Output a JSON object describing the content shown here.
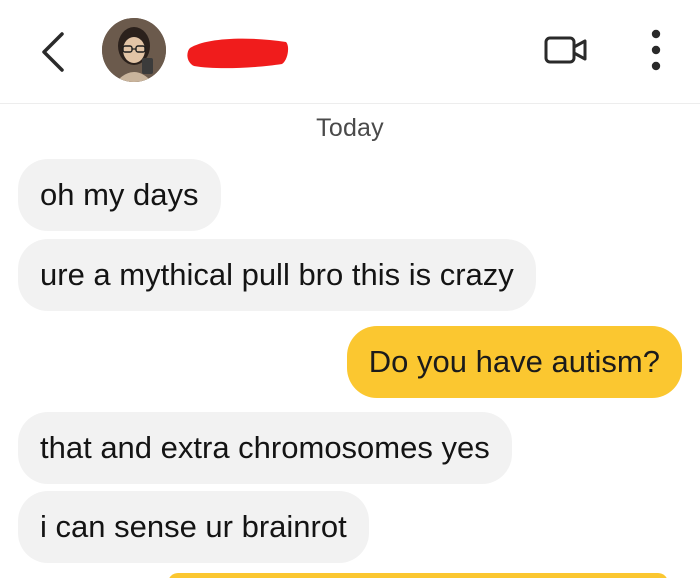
{
  "header": {
    "back_icon": "chevron-left-icon",
    "video_icon": "video-call-icon",
    "more_icon": "vertical-ellipsis-icon",
    "redaction_color": "#f01c1c"
  },
  "date_divider": "Today",
  "messages": [
    {
      "direction": "incoming",
      "text": "oh my days"
    },
    {
      "direction": "incoming",
      "text": "ure a mythical pull bro this is crazy"
    },
    {
      "direction": "outgoing",
      "text": "Do you have autism?"
    },
    {
      "direction": "incoming",
      "text": "that and extra chromosomes yes"
    },
    {
      "direction": "incoming",
      "text": "i can sense ur brainrot"
    }
  ],
  "colors": {
    "incoming_bubble": "#f2f2f2",
    "outgoing_bubble": "#fbc730",
    "text": "#141414"
  }
}
